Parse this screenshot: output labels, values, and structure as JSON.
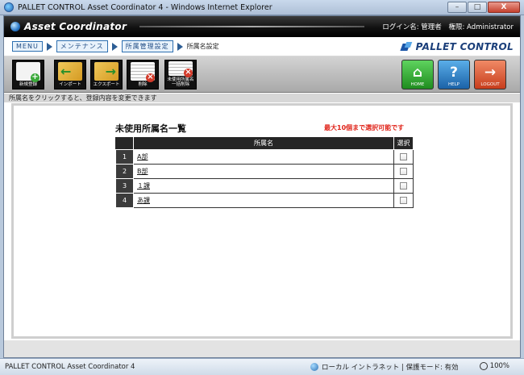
{
  "window": {
    "title": "PALLET CONTROL Asset Coordinator 4 - Windows Internet Explorer",
    "minimize": "–",
    "maximize": "□",
    "close": "X"
  },
  "header": {
    "app_name": "Asset Coordinator",
    "login_label": "ログイン名: 管理者",
    "role_label": "権限: Administrator"
  },
  "breadcrumb": {
    "items": [
      "MENU",
      "メンテナンス",
      "所属管理設定"
    ],
    "current": "所属名設定"
  },
  "brand": "PALLET CONTROL",
  "toolbar": {
    "new": "新規登録",
    "import": "インポート",
    "export": "エクスポート",
    "delete": "削除",
    "unused_delete": "未使用所属名一括削除",
    "home": "HOME",
    "help": "HELP",
    "logout": "LOGOUT"
  },
  "info": "所属名をクリックすると、登録内容を変更できます",
  "list": {
    "title": "未使用所属名一覧",
    "limit_note": "最大10個まで選択可能です",
    "columns": [
      "所属名",
      "選択"
    ],
    "rows": [
      {
        "no": "1",
        "name": "A部"
      },
      {
        "no": "2",
        "name": "B部"
      },
      {
        "no": "3",
        "name": "１課"
      },
      {
        "no": "4",
        "name": "あ課"
      }
    ]
  },
  "statusbar": {
    "left": "PALLET CONTROL Asset Coordinator 4",
    "zone": "ローカル イントラネット | 保護モード: 有効",
    "zoom": "100%"
  },
  "colors": {
    "header_bg": "#000000",
    "accent_blue": "#1b55a8",
    "limit_note": "#e0241a",
    "home": "#2fa82f",
    "help": "#2a7ccb",
    "logout": "#d9502c"
  },
  "icons": [
    "ie-icon",
    "app-logo-icon",
    "pallet-control-logo-icon",
    "new-doc-icon",
    "import-icon",
    "export-icon",
    "delete-icon",
    "unused-delete-icon",
    "home-icon",
    "help-icon",
    "logout-icon",
    "globe-icon",
    "zoom-icon"
  ]
}
